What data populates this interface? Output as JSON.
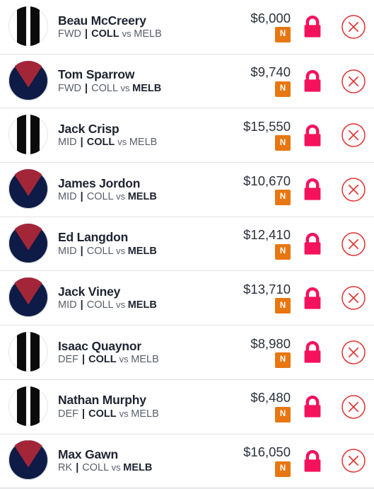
{
  "colors": {
    "lock": "#f5125d",
    "close": "#e33030",
    "badge_bg": "#e87711",
    "badge_text": "#ffffff",
    "coll_primary": "#0b0b0b",
    "coll_secondary": "#ffffff",
    "melb_primary": "#0d1b46",
    "melb_secondary": "#a32638",
    "row_bg": "#ffffff",
    "divider": "#e3e3e6",
    "name_text": "#1e2430",
    "meta_text": "#59606b",
    "price_text": "#2b313c"
  },
  "icons": {
    "lock": "lock-icon",
    "close": "close-icon",
    "badge_label": "N",
    "separator": "|",
    "versus": "vs"
  },
  "players": [
    {
      "name": "Beau McCreery",
      "position": "FWD",
      "home_team": "COLL",
      "away_team": "MELB",
      "own_team": "COLL",
      "logo": "coll",
      "price": "$6,000",
      "badge": "N",
      "lock": "lock-icon",
      "remove": "close-icon"
    },
    {
      "name": "Tom Sparrow",
      "position": "FWD",
      "home_team": "COLL",
      "away_team": "MELB",
      "own_team": "MELB",
      "logo": "melb",
      "price": "$9,740",
      "badge": "N",
      "lock": "lock-icon",
      "remove": "close-icon"
    },
    {
      "name": "Jack Crisp",
      "position": "MID",
      "home_team": "COLL",
      "away_team": "MELB",
      "own_team": "COLL",
      "logo": "coll",
      "price": "$15,550",
      "badge": "N",
      "lock": "lock-icon",
      "remove": "close-icon"
    },
    {
      "name": "James Jordon",
      "position": "MID",
      "home_team": "COLL",
      "away_team": "MELB",
      "own_team": "MELB",
      "logo": "melb",
      "price": "$10,670",
      "badge": "N",
      "lock": "lock-icon",
      "remove": "close-icon"
    },
    {
      "name": "Ed Langdon",
      "position": "MID",
      "home_team": "COLL",
      "away_team": "MELB",
      "own_team": "MELB",
      "logo": "melb",
      "price": "$12,410",
      "badge": "N",
      "lock": "lock-icon",
      "remove": "close-icon"
    },
    {
      "name": "Jack Viney",
      "position": "MID",
      "home_team": "COLL",
      "away_team": "MELB",
      "own_team": "MELB",
      "logo": "melb",
      "price": "$13,710",
      "badge": "N",
      "lock": "lock-icon",
      "remove": "close-icon"
    },
    {
      "name": "Isaac Quaynor",
      "position": "DEF",
      "home_team": "COLL",
      "away_team": "MELB",
      "own_team": "COLL",
      "logo": "coll",
      "price": "$8,980",
      "badge": "N",
      "lock": "lock-icon",
      "remove": "close-icon"
    },
    {
      "name": "Nathan Murphy",
      "position": "DEF",
      "home_team": "COLL",
      "away_team": "MELB",
      "own_team": "COLL",
      "logo": "coll",
      "price": "$6,480",
      "badge": "N",
      "lock": "lock-icon",
      "remove": "close-icon"
    },
    {
      "name": "Max Gawn",
      "position": "RK",
      "home_team": "COLL",
      "away_team": "MELB",
      "own_team": "MELB",
      "logo": "melb",
      "price": "$16,050",
      "badge": "N",
      "lock": "lock-icon",
      "remove": "close-icon"
    }
  ]
}
